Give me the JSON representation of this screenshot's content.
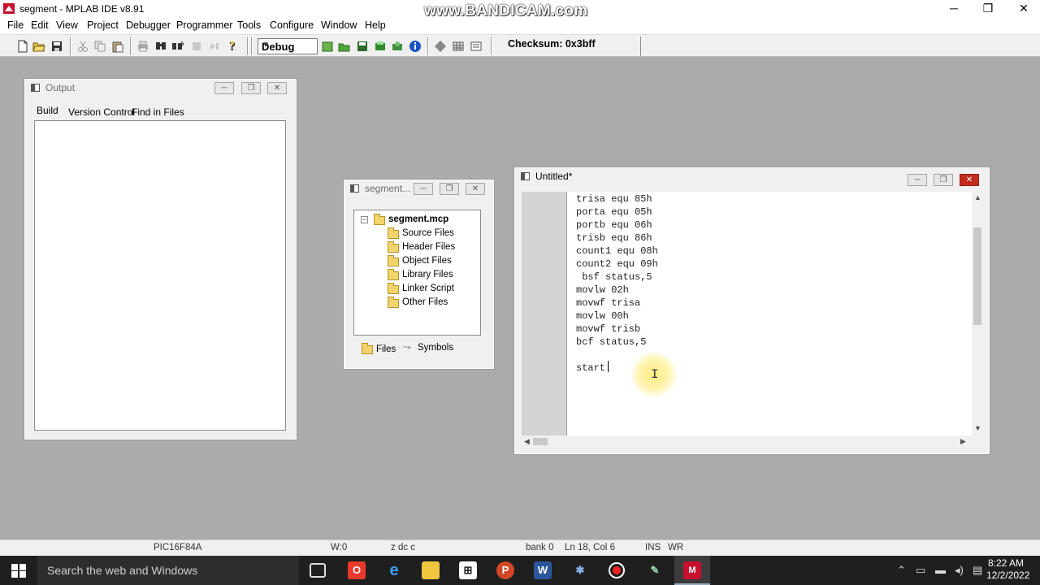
{
  "app": {
    "title": "segment - MPLAB IDE v8.91",
    "watermark": "www.BANDICAM.com",
    "minimize": "─",
    "maximize": "❐",
    "close": "✕"
  },
  "menu": [
    "File",
    "Edit",
    "View",
    "Project",
    "Debugger",
    "Programmer",
    "Tools",
    "Configure",
    "Window",
    "Help"
  ],
  "toolbar": {
    "build_config": "Debug",
    "checksum": "Checksum:  0x3bff"
  },
  "output_window": {
    "title": "Output",
    "tabs": [
      "Build",
      "Version Control",
      "Find in Files"
    ],
    "active_tab": "Build"
  },
  "project_window": {
    "title": "segment...",
    "root": "segment.mcp",
    "folders": [
      "Source Files",
      "Header Files",
      "Object Files",
      "Library Files",
      "Linker Script",
      "Other Files"
    ],
    "tabs": [
      "Files",
      "Symbols"
    ],
    "expander": "−"
  },
  "editor_window": {
    "title": "Untitled*",
    "lines": [
      "trisa equ 85h",
      "porta equ 05h",
      "portb equ 06h",
      "trisb equ 86h",
      "count1 equ 08h",
      "count2 equ 09h",
      " bsf status,5",
      "movlw 02h",
      "movwf trisa",
      "movlw 00h",
      "movwf trisb",
      "bcf status,5",
      "",
      "start"
    ]
  },
  "status_bar": {
    "device": "PIC16F84A",
    "w_reg": "W:0",
    "flags": "z dc c",
    "bank": "bank 0",
    "position": "Ln 18, Col 6",
    "ins": "INS",
    "wr": "WR"
  },
  "taskbar": {
    "search_placeholder": "Search the web and Windows",
    "time": "8:22 AM",
    "date": "12/2/2022"
  },
  "colors": {
    "accent_close": "#c42b1c",
    "mdi_background": "#ababab",
    "taskbar": "#1f1f1f",
    "cursor_highlight": "#fff08a"
  },
  "icons": {
    "toolbar": [
      "new-file-icon",
      "open-folder-icon",
      "save-icon",
      "cut-icon",
      "copy-icon",
      "paste-icon",
      "print-icon",
      "find-icon",
      "find-in-files-icon",
      "bookmark-icon",
      "build-icon",
      "help-icon"
    ],
    "taskbar": [
      "windows-start-icon",
      "task-view-icon",
      "opera-icon",
      "edge-icon",
      "file-explorer-icon",
      "store-icon",
      "powerpoint-icon",
      "word-icon",
      "settings-icon",
      "bandicam-record-icon",
      "pencil-app-icon",
      "mplab-icon"
    ]
  }
}
